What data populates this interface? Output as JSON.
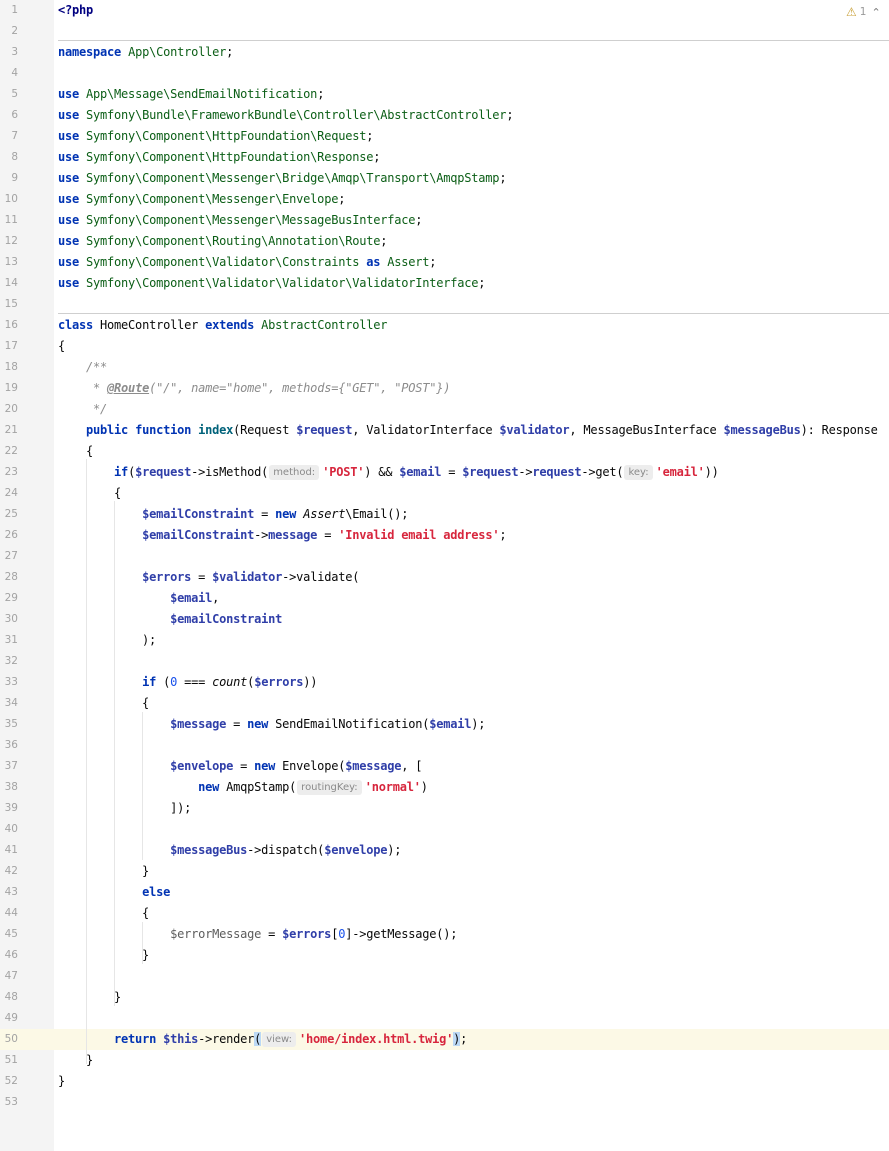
{
  "editor": {
    "language": "php",
    "inspection": {
      "warning_icon": "warning-triangle-icon",
      "warning_count": "1",
      "chevron_icon": "chevron-up-icon"
    },
    "current_line": 50,
    "lines": [
      {
        "n": "1",
        "tokens": [
          {
            "t": "<?php",
            "c": "tag"
          }
        ]
      },
      {
        "n": "2",
        "tokens": []
      },
      {
        "n": "3",
        "tokens": [
          {
            "t": "namespace",
            "c": "kw"
          },
          {
            "t": " "
          },
          {
            "t": "App\\Controller",
            "c": "ns"
          },
          {
            "t": ";"
          }
        ]
      },
      {
        "n": "4",
        "tokens": []
      },
      {
        "n": "5",
        "tokens": [
          {
            "t": "use",
            "c": "kw"
          },
          {
            "t": " "
          },
          {
            "t": "App\\Message\\SendEmailNotification",
            "c": "ns"
          },
          {
            "t": ";"
          }
        ]
      },
      {
        "n": "6",
        "tokens": [
          {
            "t": "use",
            "c": "kw"
          },
          {
            "t": " "
          },
          {
            "t": "Symfony\\Bundle\\FrameworkBundle\\Controller\\AbstractController",
            "c": "ns"
          },
          {
            "t": ";"
          }
        ]
      },
      {
        "n": "7",
        "tokens": [
          {
            "t": "use",
            "c": "kw"
          },
          {
            "t": " "
          },
          {
            "t": "Symfony\\Component\\HttpFoundation\\Request",
            "c": "ns"
          },
          {
            "t": ";"
          }
        ]
      },
      {
        "n": "8",
        "tokens": [
          {
            "t": "use",
            "c": "kw"
          },
          {
            "t": " "
          },
          {
            "t": "Symfony\\Component\\HttpFoundation\\Response",
            "c": "ns"
          },
          {
            "t": ";"
          }
        ]
      },
      {
        "n": "9",
        "tokens": [
          {
            "t": "use",
            "c": "kw"
          },
          {
            "t": " "
          },
          {
            "t": "Symfony\\Component\\Messenger\\Bridge\\Amqp\\Transport\\AmqpStamp",
            "c": "ns"
          },
          {
            "t": ";"
          }
        ]
      },
      {
        "n": "10",
        "tokens": [
          {
            "t": "use",
            "c": "kw"
          },
          {
            "t": " "
          },
          {
            "t": "Symfony\\Component\\Messenger\\Envelope",
            "c": "ns"
          },
          {
            "t": ";"
          }
        ]
      },
      {
        "n": "11",
        "tokens": [
          {
            "t": "use",
            "c": "kw"
          },
          {
            "t": " "
          },
          {
            "t": "Symfony\\Component\\Messenger\\MessageBusInterface",
            "c": "ns"
          },
          {
            "t": ";"
          }
        ]
      },
      {
        "n": "12",
        "tokens": [
          {
            "t": "use",
            "c": "kw"
          },
          {
            "t": " "
          },
          {
            "t": "Symfony\\Component\\Routing\\Annotation\\Route",
            "c": "ns"
          },
          {
            "t": ";"
          }
        ]
      },
      {
        "n": "13",
        "tokens": [
          {
            "t": "use",
            "c": "kw"
          },
          {
            "t": " "
          },
          {
            "t": "Symfony\\Component\\Validator\\Constraints",
            "c": "ns"
          },
          {
            "t": " "
          },
          {
            "t": "as",
            "c": "kw"
          },
          {
            "t": " "
          },
          {
            "t": "Assert",
            "c": "ns"
          },
          {
            "t": ";"
          }
        ]
      },
      {
        "n": "14",
        "tokens": [
          {
            "t": "use",
            "c": "kw"
          },
          {
            "t": " "
          },
          {
            "t": "Symfony\\Component\\Validator\\Validator\\ValidatorInterface",
            "c": "ns"
          },
          {
            "t": ";"
          }
        ]
      },
      {
        "n": "15",
        "tokens": []
      },
      {
        "n": "16",
        "tokens": [
          {
            "t": "class",
            "c": "kw"
          },
          {
            "t": " HomeController "
          },
          {
            "t": "extends",
            "c": "kw"
          },
          {
            "t": " "
          },
          {
            "t": "AbstractController",
            "c": "ns"
          }
        ]
      },
      {
        "n": "17",
        "tokens": [
          {
            "t": "{"
          }
        ]
      },
      {
        "n": "18",
        "tokens": [
          {
            "t": "    "
          },
          {
            "t": "/**",
            "c": "cm"
          }
        ]
      },
      {
        "n": "19",
        "tokens": [
          {
            "t": "     "
          },
          {
            "t": "* ",
            "c": "cm"
          },
          {
            "t": "@Route",
            "c": "doc-tag"
          },
          {
            "t": "(\"/\", name=\"home\", methods={\"GET\", \"POST\"})",
            "c": "cm"
          }
        ]
      },
      {
        "n": "20",
        "tokens": [
          {
            "t": "     "
          },
          {
            "t": "*/",
            "c": "cm"
          }
        ]
      },
      {
        "n": "21",
        "tokens": [
          {
            "t": "    "
          },
          {
            "t": "public",
            "c": "kw"
          },
          {
            "t": " "
          },
          {
            "t": "function",
            "c": "kw"
          },
          {
            "t": " "
          },
          {
            "t": "index",
            "c": "fn"
          },
          {
            "t": "(Request "
          },
          {
            "t": "$request",
            "c": "var"
          },
          {
            "t": ", ValidatorInterface "
          },
          {
            "t": "$validator",
            "c": "var"
          },
          {
            "t": ", MessageBusInterface "
          },
          {
            "t": "$messageBus",
            "c": "var"
          },
          {
            "t": "): Response"
          }
        ]
      },
      {
        "n": "22",
        "tokens": [
          {
            "t": "    {"
          }
        ]
      },
      {
        "n": "23",
        "tokens": [
          {
            "t": "        "
          },
          {
            "t": "if",
            "c": "kw"
          },
          {
            "t": "("
          },
          {
            "t": "$request",
            "c": "var"
          },
          {
            "t": "->isMethod("
          },
          {
            "hint": "method:"
          },
          {
            "t": "'POST'",
            "c": "str"
          },
          {
            "t": ") && "
          },
          {
            "t": "$email",
            "c": "var"
          },
          {
            "t": " = "
          },
          {
            "t": "$request",
            "c": "var"
          },
          {
            "t": "->"
          },
          {
            "t": "request",
            "c": "var"
          },
          {
            "t": "->get("
          },
          {
            "hint": "key:"
          },
          {
            "t": "'email'",
            "c": "str"
          },
          {
            "t": "))"
          }
        ]
      },
      {
        "n": "24",
        "tokens": [
          {
            "t": "        {"
          }
        ]
      },
      {
        "n": "25",
        "tokens": [
          {
            "t": "            "
          },
          {
            "t": "$emailConstraint",
            "c": "var"
          },
          {
            "t": " = "
          },
          {
            "t": "new",
            "c": "kw"
          },
          {
            "t": " "
          },
          {
            "t": "Assert",
            "c": "it"
          },
          {
            "t": "\\Email();"
          }
        ]
      },
      {
        "n": "26",
        "tokens": [
          {
            "t": "            "
          },
          {
            "t": "$emailConstraint",
            "c": "var"
          },
          {
            "t": "->"
          },
          {
            "t": "message",
            "c": "var"
          },
          {
            "t": " = "
          },
          {
            "t": "'Invalid email address'",
            "c": "str"
          },
          {
            "t": ";"
          }
        ]
      },
      {
        "n": "27",
        "tokens": []
      },
      {
        "n": "28",
        "tokens": [
          {
            "t": "            "
          },
          {
            "t": "$errors",
            "c": "var"
          },
          {
            "t": " = "
          },
          {
            "t": "$validator",
            "c": "var"
          },
          {
            "t": "->validate("
          }
        ]
      },
      {
        "n": "29",
        "tokens": [
          {
            "t": "                "
          },
          {
            "t": "$email",
            "c": "var"
          },
          {
            "t": ","
          }
        ]
      },
      {
        "n": "30",
        "tokens": [
          {
            "t": "                "
          },
          {
            "t": "$emailConstraint",
            "c": "var"
          }
        ]
      },
      {
        "n": "31",
        "tokens": [
          {
            "t": "            );"
          }
        ]
      },
      {
        "n": "32",
        "tokens": []
      },
      {
        "n": "33",
        "tokens": [
          {
            "t": "            "
          },
          {
            "t": "if",
            "c": "kw"
          },
          {
            "t": " ("
          },
          {
            "t": "0",
            "c": "num"
          },
          {
            "t": " === "
          },
          {
            "t": "count",
            "c": "it"
          },
          {
            "t": "("
          },
          {
            "t": "$errors",
            "c": "var"
          },
          {
            "t": "))"
          }
        ]
      },
      {
        "n": "34",
        "tokens": [
          {
            "t": "            {"
          }
        ]
      },
      {
        "n": "35",
        "tokens": [
          {
            "t": "                "
          },
          {
            "t": "$message",
            "c": "var"
          },
          {
            "t": " = "
          },
          {
            "t": "new",
            "c": "kw"
          },
          {
            "t": " SendEmailNotification("
          },
          {
            "t": "$email",
            "c": "var"
          },
          {
            "t": ");"
          }
        ]
      },
      {
        "n": "36",
        "tokens": []
      },
      {
        "n": "37",
        "tokens": [
          {
            "t": "                "
          },
          {
            "t": "$envelope",
            "c": "var"
          },
          {
            "t": " = "
          },
          {
            "t": "new",
            "c": "kw"
          },
          {
            "t": " Envelope("
          },
          {
            "t": "$message",
            "c": "var"
          },
          {
            "t": ", ["
          }
        ]
      },
      {
        "n": "38",
        "tokens": [
          {
            "t": "                    "
          },
          {
            "t": "new",
            "c": "kw"
          },
          {
            "t": " AmqpStamp("
          },
          {
            "hint": "routingKey:"
          },
          {
            "t": "'normal'",
            "c": "str"
          },
          {
            "t": ")"
          }
        ]
      },
      {
        "n": "39",
        "tokens": [
          {
            "t": "                ]);"
          }
        ]
      },
      {
        "n": "40",
        "tokens": []
      },
      {
        "n": "41",
        "tokens": [
          {
            "t": "                "
          },
          {
            "t": "$messageBus",
            "c": "var"
          },
          {
            "t": "->dispatch("
          },
          {
            "t": "$envelope",
            "c": "var"
          },
          {
            "t": ");"
          }
        ]
      },
      {
        "n": "42",
        "tokens": [
          {
            "t": "            }"
          }
        ]
      },
      {
        "n": "43",
        "tokens": [
          {
            "t": "            "
          },
          {
            "t": "else",
            "c": "kw"
          }
        ]
      },
      {
        "n": "44",
        "tokens": [
          {
            "t": "            {"
          }
        ]
      },
      {
        "n": "45",
        "tokens": [
          {
            "t": "                "
          },
          {
            "t": "$errorMessage",
            "c": "var-muted"
          },
          {
            "t": " = "
          },
          {
            "t": "$errors",
            "c": "var"
          },
          {
            "t": "["
          },
          {
            "t": "0",
            "c": "num"
          },
          {
            "t": "]->getMessage();"
          }
        ]
      },
      {
        "n": "46",
        "tokens": [
          {
            "t": "            }"
          }
        ]
      },
      {
        "n": "47",
        "tokens": []
      },
      {
        "n": "48",
        "tokens": [
          {
            "t": "        }"
          }
        ]
      },
      {
        "n": "49",
        "tokens": []
      },
      {
        "n": "50",
        "tokens": [
          {
            "t": "        "
          },
          {
            "t": "return",
            "c": "kw"
          },
          {
            "t": " "
          },
          {
            "t": "$this",
            "c": "var"
          },
          {
            "t": "->render"
          },
          {
            "t": "(",
            "c": "brace-match"
          },
          {
            "hint": "view:"
          },
          {
            "t": "'home/index.html.twig'",
            "c": "str"
          },
          {
            "t": ")",
            "c": "brace-match"
          },
          {
            "t": ";"
          }
        ]
      },
      {
        "n": "51",
        "tokens": [
          {
            "t": "    }"
          }
        ]
      },
      {
        "n": "52",
        "tokens": [
          {
            "t": "}"
          }
        ]
      },
      {
        "n": "53",
        "tokens": []
      }
    ]
  }
}
